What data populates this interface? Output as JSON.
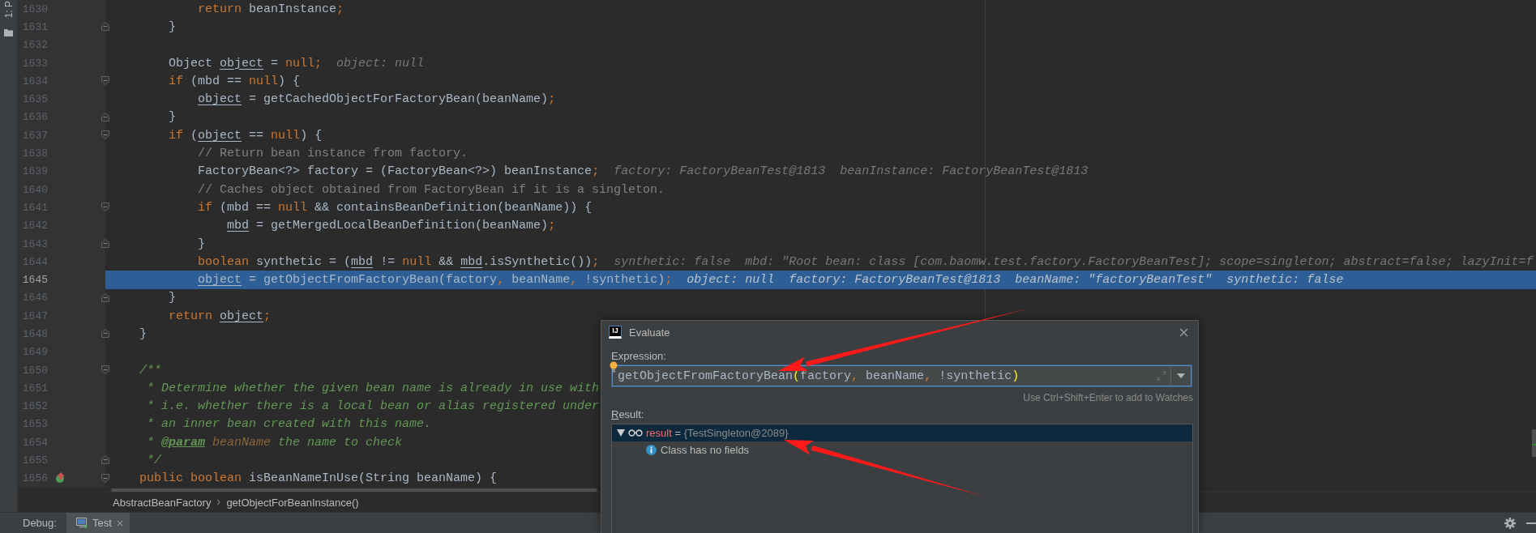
{
  "tool_window_stripe": {
    "label": "1: P"
  },
  "editor": {
    "lines": [
      {
        "number": "1630",
        "current": false,
        "code": [
          {
            "kind": "keyword",
            "text": "            return"
          },
          {
            "kind": "plain",
            "text": " beanInstance"
          },
          {
            "kind": "keyword",
            "text": ";"
          }
        ]
      },
      {
        "number": "1631",
        "current": false,
        "fold_close": true,
        "code": [
          {
            "kind": "plain",
            "text": "        }"
          }
        ]
      },
      {
        "number": "1632",
        "current": false
      },
      {
        "number": "1633",
        "current": false,
        "code": [
          {
            "kind": "plain",
            "text": "        Object "
          },
          {
            "kind": "var",
            "text": "object"
          },
          {
            "kind": "plain",
            "text": " = "
          },
          {
            "kind": "keyword",
            "text": "null;"
          }
        ],
        "hint": "object: null"
      },
      {
        "number": "1634",
        "current": false,
        "fold_open": true,
        "code": [
          {
            "kind": "keyword",
            "text": "        if"
          },
          {
            "kind": "plain",
            "text": " (mbd == "
          },
          {
            "kind": "keyword",
            "text": "null"
          },
          {
            "kind": "plain",
            "text": ") {"
          }
        ]
      },
      {
        "number": "1635",
        "current": false,
        "code": [
          {
            "kind": "var",
            "text": "            object"
          },
          {
            "kind": "plain",
            "text": " = getCachedObjectForFactoryBean(beanName)"
          },
          {
            "kind": "keyword",
            "text": ";"
          }
        ]
      },
      {
        "number": "1636",
        "current": false,
        "fold_close": true,
        "code": [
          {
            "kind": "plain",
            "text": "        }"
          }
        ]
      },
      {
        "number": "1637",
        "current": false,
        "fold_open": true,
        "code": [
          {
            "kind": "keyword",
            "text": "        if"
          },
          {
            "kind": "plain",
            "text": " ("
          },
          {
            "kind": "var",
            "text": "object"
          },
          {
            "kind": "plain",
            "text": " == "
          },
          {
            "kind": "keyword",
            "text": "null"
          },
          {
            "kind": "plain",
            "text": ") {"
          }
        ]
      },
      {
        "number": "1638",
        "current": false,
        "code": [
          {
            "kind": "comment",
            "text": "            // Return bean instance from factory."
          }
        ]
      },
      {
        "number": "1639",
        "current": false,
        "code": [
          {
            "kind": "plain",
            "text": "            FactoryBean<?> factory = (FactoryBean<?>) beanInstance"
          },
          {
            "kind": "keyword",
            "text": ";"
          }
        ],
        "hint": "factory: FactoryBeanTest@1813  beanInstance: FactoryBeanTest@1813"
      },
      {
        "number": "1640",
        "current": false,
        "code": [
          {
            "kind": "comment",
            "text": "            // Caches object obtained from FactoryBean if it is a singleton."
          }
        ]
      },
      {
        "number": "1641",
        "current": false,
        "fold_open": true,
        "code": [
          {
            "kind": "keyword",
            "text": "            if"
          },
          {
            "kind": "plain",
            "text": " (mbd == "
          },
          {
            "kind": "keyword",
            "text": "null"
          },
          {
            "kind": "plain",
            "text": " && containsBeanDefinition(beanName)) {"
          }
        ]
      },
      {
        "number": "1642",
        "current": false,
        "code": [
          {
            "kind": "var",
            "text": "                mbd"
          },
          {
            "kind": "plain",
            "text": " = getMergedLocalBeanDefinition(beanName)"
          },
          {
            "kind": "keyword",
            "text": ";"
          }
        ]
      },
      {
        "number": "1643",
        "current": false,
        "fold_close": true,
        "code": [
          {
            "kind": "plain",
            "text": "            }"
          }
        ]
      },
      {
        "number": "1644",
        "current": false,
        "code": [
          {
            "kind": "keyword",
            "text": "            boolean"
          },
          {
            "kind": "plain",
            "text": " synthetic = ("
          },
          {
            "kind": "var",
            "text": "mbd"
          },
          {
            "kind": "plain",
            "text": " != "
          },
          {
            "kind": "keyword",
            "text": "null"
          },
          {
            "kind": "plain",
            "text": " && "
          },
          {
            "kind": "var",
            "text": "mbd"
          },
          {
            "kind": "plain",
            "text": ".isSynthetic())"
          },
          {
            "kind": "keyword",
            "text": ";"
          }
        ],
        "hint": "synthetic: false  mbd: \"Root bean: class [com.baomw.test.factory.FactoryBeanTest]; scope=singleton; abstract=false; lazyInit=f"
      },
      {
        "number": "1645",
        "current": true,
        "code": [
          {
            "kind": "var",
            "text": "            object"
          },
          {
            "kind": "plain",
            "text": " = getObjectFromFactoryBean(factory"
          },
          {
            "kind": "keyword",
            "text": ","
          },
          {
            "kind": "plain",
            "text": " beanName"
          },
          {
            "kind": "keyword",
            "text": ","
          },
          {
            "kind": "plain",
            "text": " !synthetic)"
          },
          {
            "kind": "keyword",
            "text": ";"
          }
        ],
        "hint": "object: null  factory: FactoryBeanTest@1813  beanName: \"factoryBeanTest\"  synthetic: false"
      },
      {
        "number": "1646",
        "current": false,
        "fold_close": true,
        "code": [
          {
            "kind": "plain",
            "text": "        }"
          }
        ]
      },
      {
        "number": "1647",
        "current": false,
        "code": [
          {
            "kind": "keyword",
            "text": "        return"
          },
          {
            "kind": "var",
            "text": " object"
          },
          {
            "kind": "keyword",
            "text": ";"
          }
        ]
      },
      {
        "number": "1648",
        "current": false,
        "fold_close": true,
        "code": [
          {
            "kind": "plain",
            "text": "    }"
          }
        ]
      },
      {
        "number": "1649",
        "current": false
      },
      {
        "number": "1650",
        "current": false,
        "fold_open": true,
        "code": [
          {
            "kind": "doc",
            "text": "    /**"
          }
        ]
      },
      {
        "number": "1651",
        "current": false,
        "code": [
          {
            "kind": "doc",
            "text": "     * Determine whether the given bean name is already in use with"
          }
        ]
      },
      {
        "number": "1652",
        "current": false,
        "code": [
          {
            "kind": "doc",
            "text": "     * i.e. whether there is a local bean or alias registered under"
          }
        ]
      },
      {
        "number": "1653",
        "current": false,
        "code": [
          {
            "kind": "doc",
            "text": "     * an inner bean created with this name."
          }
        ]
      },
      {
        "number": "1654",
        "current": false,
        "code": [
          {
            "kind": "doc",
            "text": "     * "
          },
          {
            "kind": "doctag",
            "text": "@param"
          },
          {
            "kind": "docparam",
            "text": " beanName"
          },
          {
            "kind": "doc",
            "text": " the name to check"
          }
        ]
      },
      {
        "number": "1655",
        "current": false,
        "fold_close": true,
        "code": [
          {
            "kind": "doc",
            "text": "     */"
          }
        ]
      },
      {
        "number": "1656",
        "current": false,
        "fold_open": true,
        "override_marker": true,
        "code": [
          {
            "kind": "keyword",
            "text": "    public boolean"
          },
          {
            "kind": "plain",
            "text": " isBeanNameInUse(String beanName) {"
          }
        ]
      }
    ]
  },
  "breadcrumbs": [
    "AbstractBeanFactory",
    "getObjectForBeanInstance()"
  ],
  "debug_bar": {
    "label": "Debug:",
    "tabs": [
      {
        "label": "Test",
        "selected": true
      }
    ]
  },
  "evaluate_dialog": {
    "logo": "IJ",
    "title": "Evaluate",
    "expression_label": "Expression:",
    "expression": [
      {
        "kind": "plain",
        "text": "getObjectFromFactoryBean"
      },
      {
        "kind": "brace",
        "text": "("
      },
      {
        "kind": "plain",
        "text": "factory"
      },
      {
        "kind": "keyword",
        "text": ","
      },
      {
        "kind": "plain",
        "text": " beanName"
      },
      {
        "kind": "keyword",
        "text": ","
      },
      {
        "kind": "plain",
        "text": " !synthetic"
      },
      {
        "kind": "brace",
        "text": ")"
      }
    ],
    "watch_hint": "Use Ctrl+Shift+Enter to add to Watches",
    "result_label": "Result:",
    "result_tree": [
      {
        "name": "result",
        "separator": "=",
        "value": "{TestSingleton@2089}",
        "expanded": true,
        "selected": true,
        "children": [
          {
            "kind": "info",
            "text": "Class has no fields",
            "selected": false
          }
        ]
      }
    ]
  }
}
